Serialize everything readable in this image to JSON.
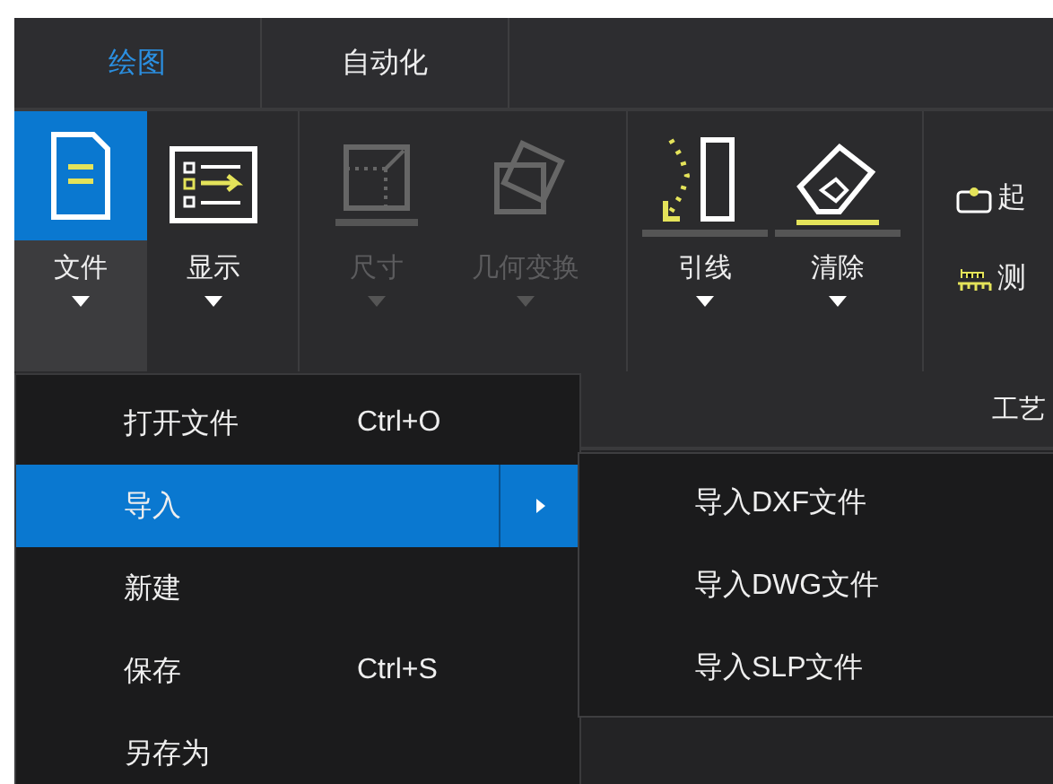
{
  "tabs": [
    {
      "label": "绘图",
      "selected": true
    },
    {
      "label": "自动化",
      "selected": false
    }
  ],
  "ribbon": {
    "groups": [
      {
        "buttons": [
          {
            "label": "文件",
            "kind": "file",
            "selected": true,
            "disabled": false
          },
          {
            "label": "显示",
            "kind": "display",
            "selected": false,
            "disabled": false
          }
        ]
      },
      {
        "buttons": [
          {
            "label": "尺寸",
            "kind": "size",
            "selected": false,
            "disabled": true
          },
          {
            "label": "几何变换",
            "kind": "transform",
            "selected": false,
            "disabled": true
          }
        ]
      },
      {
        "buttons": [
          {
            "label": "引线",
            "kind": "lead",
            "selected": false,
            "disabled": false
          },
          {
            "label": "清除",
            "kind": "clear",
            "selected": false,
            "disabled": false
          }
        ]
      }
    ],
    "small_items": [
      {
        "label": "起",
        "kind": "start"
      },
      {
        "label": "测",
        "kind": "ruler"
      }
    ],
    "group_label": "工艺"
  },
  "file_menu": [
    {
      "label": "打开文件",
      "shortcut": "Ctrl+O",
      "selected": false,
      "submenu": false
    },
    {
      "label": "导入",
      "selected": true,
      "submenu": true
    },
    {
      "label": "新建",
      "selected": false,
      "submenu": false
    },
    {
      "label": "保存",
      "shortcut": "Ctrl+S",
      "selected": false,
      "submenu": false
    },
    {
      "label": "另存为",
      "selected": false,
      "submenu": false
    }
  ],
  "submenu": [
    {
      "label": "导入DXF文件"
    },
    {
      "label": "导入DWG文件"
    },
    {
      "label": "导入SLP文件"
    }
  ]
}
